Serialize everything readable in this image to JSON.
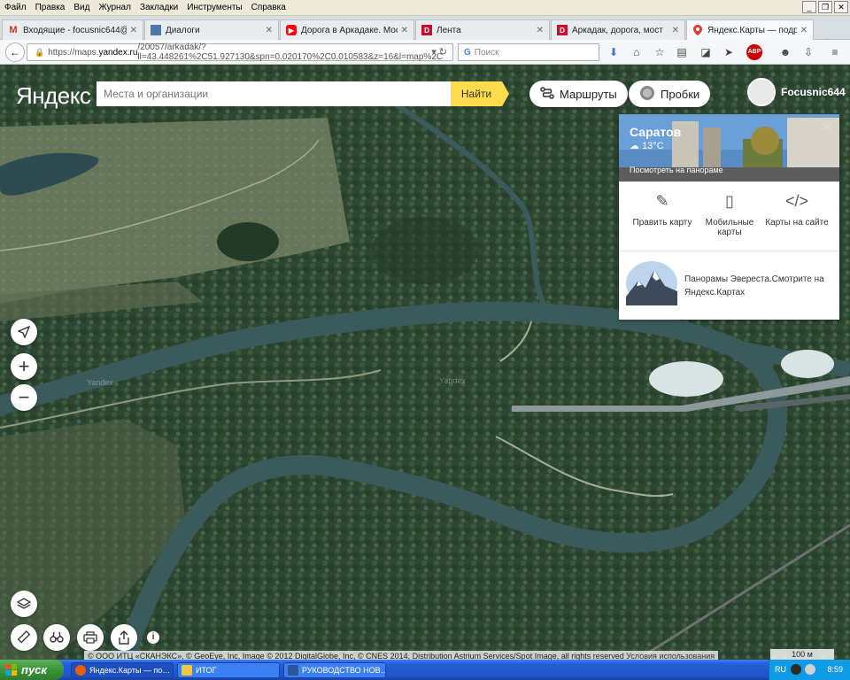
{
  "menu": [
    "Файл",
    "Правка",
    "Вид",
    "Журнал",
    "Закладки",
    "Инструменты",
    "Справка"
  ],
  "tabs": [
    {
      "title": "Входящие - focusnic644@g…",
      "icon": "gmail-icon",
      "color": "#d93025",
      "glyph": "M",
      "active": false
    },
    {
      "title": "Диалоги",
      "icon": "vk-dialogs-icon",
      "color": "#4a76a8",
      "glyph": "▪",
      "active": false
    },
    {
      "title": "Дорога в Аркадаке. Мост…",
      "icon": "youtube-icon",
      "color": "#ff0000",
      "glyph": "▶",
      "active": false
    },
    {
      "title": "Лента",
      "icon": "drive2-icon",
      "color": "#c8102e",
      "glyph": "D",
      "active": false
    },
    {
      "title": "Аркадак, дорога, мост",
      "icon": "drive2-icon",
      "color": "#c8102e",
      "glyph": "D",
      "active": false
    },
    {
      "title": "Яндекс.Карты — подробн…",
      "icon": "yandex-maps-pin-icon",
      "color": "#e53935",
      "glyph": "●",
      "active": true
    }
  ],
  "url": {
    "prefix": "https://maps.",
    "domain": "yandex.ru",
    "rest": "/20057/arkadak/?ll=43.448261%2C51.927130&spn=0.020170%2C0.010583&z=16&l=map%2C"
  },
  "search_placeholder": "Поиск",
  "yandex": {
    "logo": "Яндекс",
    "search_placeholder": "Места и организации",
    "find_label": "Найти",
    "routes_label": "Маршруты",
    "traffic_label": "Пробки",
    "username": "Focusnic644"
  },
  "panel": {
    "city": "Саратов",
    "temperature": "13°C",
    "panorama_link": "Посмотреть на панораме",
    "actions": [
      {
        "label": "Править карту",
        "icon": "edit-pencil-icon"
      },
      {
        "label": "Мобильные карты",
        "icon": "mobile-phone-icon"
      },
      {
        "label": "Карты на сайте",
        "icon": "code-brackets-icon"
      }
    ],
    "promo_text": "Панорамы Эвереста.Смотрите на Яндекс.Картах"
  },
  "map": {
    "watermarks": [
      "Yandex",
      "Yandex"
    ],
    "attribution": "© ООО ИТЦ «СКАНЭКС», © GeoEye, Inc, Image © 2012 DigitalGlobe, Inc, © CNES 2014, Distribution Astrium Services/Spot Image, all rights reserved",
    "terms_link": "Условия использования",
    "scale": "100 м"
  },
  "taskbar": {
    "start_label": "пуск",
    "tasks": [
      {
        "label": "Яндекс.Карты — по…",
        "color": "#e66000",
        "active": true
      },
      {
        "label": "ИТОГ",
        "color": "#f4c542",
        "active": false
      },
      {
        "label": "РУКОВОДСТВО НОВ…",
        "color": "#2b579a",
        "active": false
      }
    ],
    "lang": "RU",
    "clock": "8:59"
  },
  "colors": {
    "yandex_yellow": "#ffdb4d",
    "river": "#3b5a5c",
    "forest": "#2f4a34",
    "taskbar_blue": "#245edb"
  }
}
